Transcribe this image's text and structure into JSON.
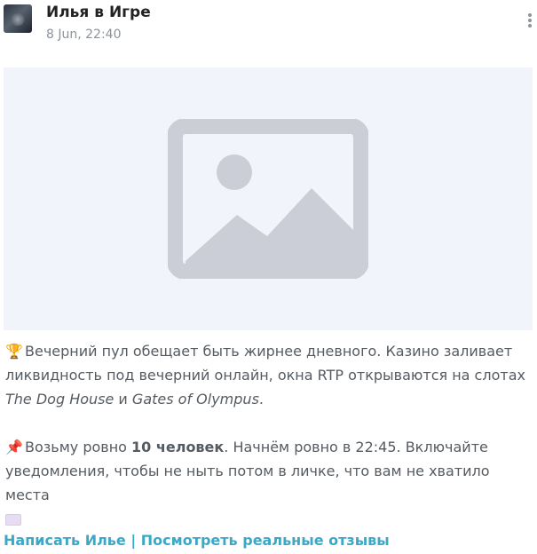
{
  "post": {
    "author": "Илья в Игре",
    "date": "8 Jun, 22:40"
  },
  "message": {
    "p1_emoji": "🏆",
    "p1_text_a": "Вечерний пул обещает быть жирнее дневного. Казино заливает ликвидность под вечерний онлайн, окна RTP открываются на слотах ",
    "p1_slot1": "The Dog House",
    "p1_and": " и ",
    "p1_slot2": "Gates of Olympus",
    "p1_end": ".",
    "p2_emoji": "📌",
    "p2_text_a": "Возьму ровно ",
    "p2_bold": "10 человек",
    "p2_text_b": ". Начнём ровно в 22:45. Включайте уведомления, чтобы не ныть потом в личке, что вам не хватило места"
  },
  "links": {
    "write": "Написать Илье",
    "separator": " | ",
    "reviews": "Посмотреть реальные отзывы"
  },
  "colors": {
    "link": "#3aa8c6",
    "placeholder_bg": "#f1f4fa",
    "placeholder_icon": "#cbced6"
  }
}
